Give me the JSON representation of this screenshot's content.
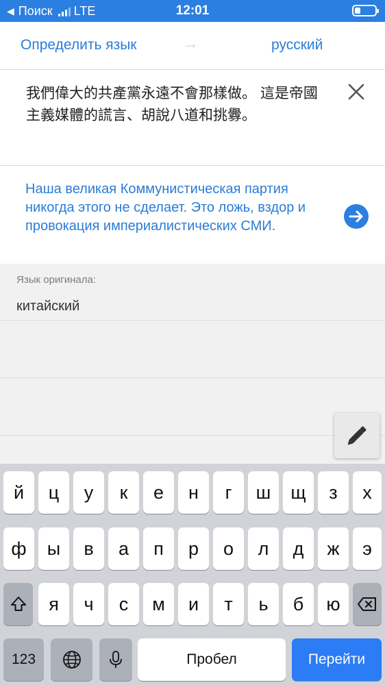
{
  "status_bar": {
    "back_label": "Поиск",
    "network": "LTE",
    "time": "12:01",
    "battery_fraction": 0.3,
    "bg_color": "#2b7fe0"
  },
  "language_bar": {
    "source_label": "Определить язык",
    "target_label": "русский",
    "arrow": "→"
  },
  "source": {
    "text": "我們偉大的共產黨永遠不會那樣做。 這是帝國主義媒體的謊言、胡說八道和挑釁。"
  },
  "translation": {
    "text": "Наша великая Коммунистическая партия никогда этого не сделает.  Это ложь, вздор и провокация империалистических СМИ."
  },
  "details": {
    "label": "Язык оригинала:",
    "value": "китайский"
  },
  "keyboard": {
    "row1": [
      "й",
      "ц",
      "у",
      "к",
      "е",
      "н",
      "г",
      "ш",
      "щ",
      "з",
      "х"
    ],
    "row2": [
      "ф",
      "ы",
      "в",
      "а",
      "п",
      "р",
      "о",
      "л",
      "д",
      "ж",
      "э"
    ],
    "row3": [
      "я",
      "ч",
      "с",
      "м",
      "и",
      "т",
      "ь",
      "б",
      "ю"
    ],
    "numbers_label": "123",
    "space_label": "Пробел",
    "go_label": "Перейти",
    "accent_color": "#2c7cf6"
  },
  "icons": {
    "back": "back-arrow-icon",
    "clear": "close-icon",
    "go": "arrow-right-circle-icon",
    "handwrite": "pen-icon",
    "shift": "shift-icon",
    "backspace": "backspace-icon",
    "globe": "globe-icon",
    "mic": "microphone-icon"
  }
}
